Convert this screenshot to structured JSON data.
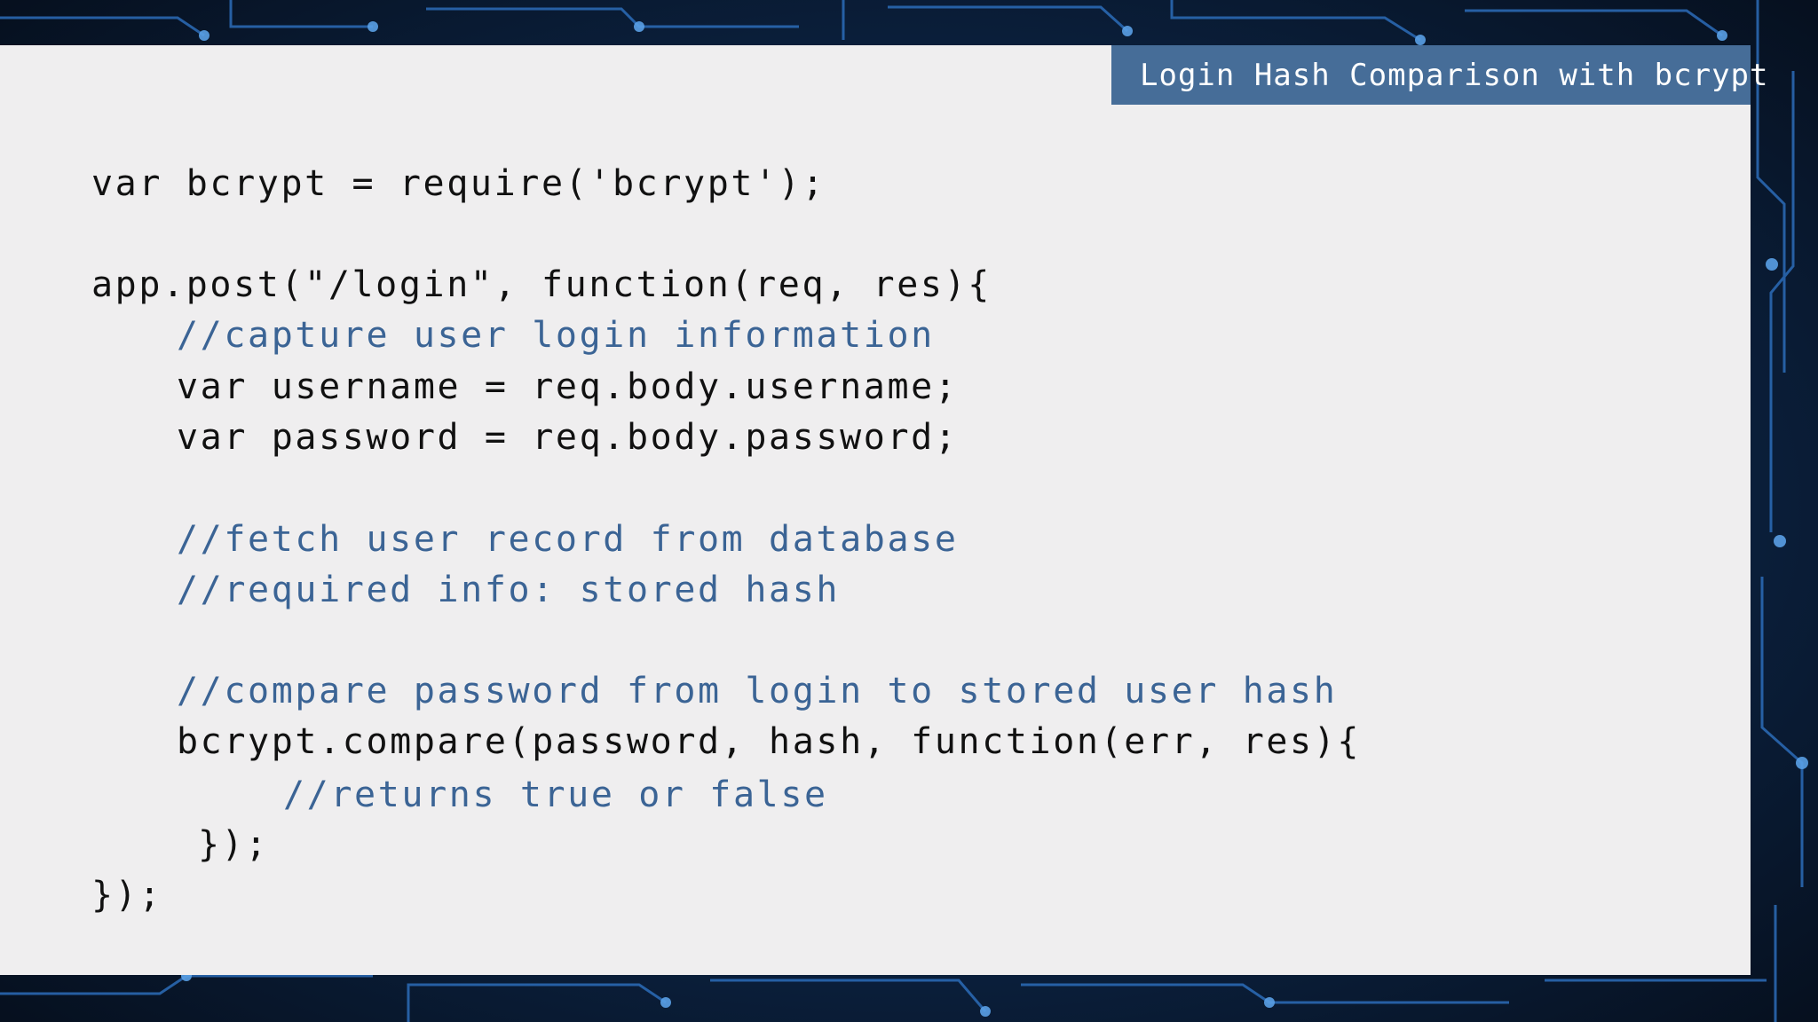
{
  "slide": {
    "title": "Login Hash Comparison with bcrypt"
  },
  "code": {
    "lines": [
      {
        "text": "var bcrypt = require('bcrypt');",
        "kind": "code",
        "indent": 0
      },
      {
        "text": "app.post(\"/login\", function(req, res){",
        "kind": "code",
        "indent": 0
      },
      {
        "text": "//capture user login information",
        "kind": "comment",
        "indent": 1
      },
      {
        "text": "var username = req.body.username;",
        "kind": "code",
        "indent": 1
      },
      {
        "text": "var password = req.body.password;",
        "kind": "code",
        "indent": 1
      },
      {
        "text": "//fetch user record from database",
        "kind": "comment",
        "indent": 1
      },
      {
        "text": "//required info: stored hash",
        "kind": "comment",
        "indent": 1
      },
      {
        "text": "//compare password from login to stored user hash",
        "kind": "comment",
        "indent": 1
      },
      {
        "text": "bcrypt.compare(password, hash, function(err, res){",
        "kind": "code",
        "indent": 1
      },
      {
        "text": "//returns true or false",
        "kind": "comment",
        "indent": 2
      },
      {
        "text": "});",
        "kind": "code",
        "indent": 1
      },
      {
        "text": "});",
        "kind": "code",
        "indent": 0
      }
    ]
  },
  "colors": {
    "title_bar": "#466d98",
    "card": "#efeeef",
    "comment": "#3b6495",
    "code": "#111111",
    "background": "#0b1a33"
  }
}
